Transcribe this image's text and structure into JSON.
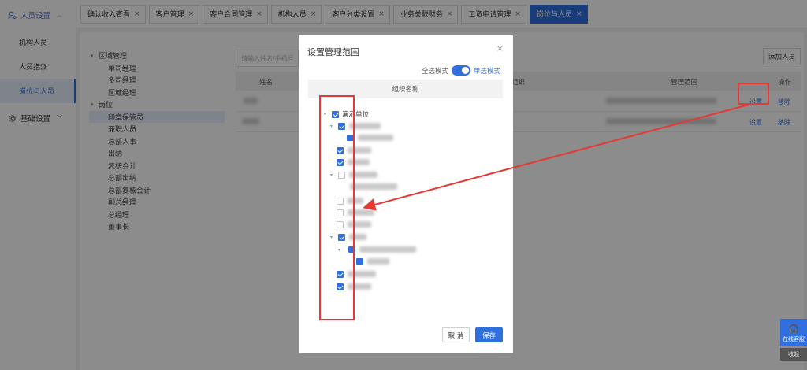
{
  "sidebar": {
    "group1": "人员设置",
    "items": [
      "机构人员",
      "人员指派",
      "岗位与人员"
    ],
    "group2": "基础设置"
  },
  "tabs": [
    {
      "label": "确认收入查看"
    },
    {
      "label": "客户管理"
    },
    {
      "label": "客户合同管理"
    },
    {
      "label": "机构人员"
    },
    {
      "label": "客户分类设置"
    },
    {
      "label": "业务关联财务"
    },
    {
      "label": "工资申请管理"
    },
    {
      "label": "岗位与人员"
    }
  ],
  "bgtree": {
    "n0": "区域管理",
    "n1": "单司经理",
    "n2": "多司经理",
    "n3": "区域经理",
    "n4": "岗位",
    "n5": "印章保管员",
    "n6": "兼职人员",
    "n7": "总部人事",
    "n8": "出纳",
    "n9": "复核会计",
    "n10": "总部出纳",
    "n11": "总部复核会计",
    "n12": "副总经理",
    "n13": "总经理",
    "n14": "董事长"
  },
  "table": {
    "search_placeholder": "请输入姓名/手机号",
    "add_button": "添加人员",
    "col_name": "姓名",
    "col_org": "组织",
    "col_scope": "管理范围",
    "col_op": "操作",
    "rows": [
      {
        "set": "设置",
        "remove": "移除"
      },
      {
        "set": "设置",
        "remove": "移除"
      }
    ]
  },
  "modal": {
    "title": "设置管理范围",
    "close": "×",
    "mode_all": "全选模式",
    "mode_single": "单选模式",
    "column": "组织名称",
    "root_label": "演示单位",
    "cancel": "取 消",
    "save": "保存"
  },
  "widgets": {
    "service": "在线客服",
    "collapse": "收起"
  },
  "colors": {
    "accent": "#2f6fde",
    "annotation": "#e53935"
  }
}
